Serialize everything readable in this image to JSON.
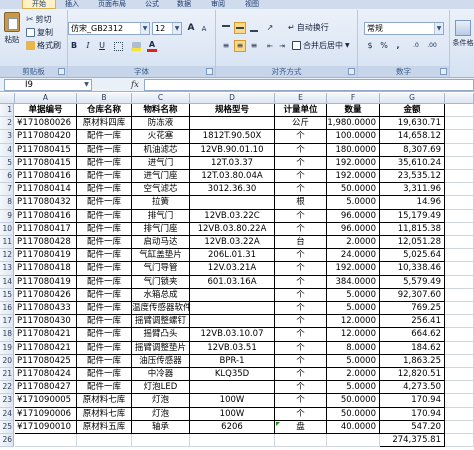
{
  "ribbon": {
    "tabs": [
      "开始",
      "插入",
      "页面布局",
      "公式",
      "数据",
      "审阅",
      "视图"
    ],
    "clipboard": {
      "label": "剪贴板",
      "paste": "粘贴",
      "cut": "剪切",
      "copy": "复制",
      "format_painter": "格式刷"
    },
    "font": {
      "label": "字体",
      "name": "仿宋_GB2312",
      "size": "12",
      "bold": "B",
      "italic": "I",
      "underline": "U",
      "font_color_glyph": "A",
      "grow": "A",
      "shrink": "A"
    },
    "alignment": {
      "label": "对齐方式",
      "wrap": "自动换行",
      "merge": "合并后居中"
    },
    "number": {
      "label": "数字",
      "format": "常规",
      "currency": "$",
      "percent": "%",
      "comma": ",",
      "inc_dec": ".0",
      "dec_dec": ".00"
    },
    "styles": {
      "cond_format": "条件格"
    },
    "colors": {
      "accent": "#fbd98a",
      "font_red": "#e02020",
      "fill_yellow": "#f5e33a",
      "link_blue": "#1e3a6a"
    }
  },
  "formula_bar": {
    "name_box": "I9",
    "fx": "fx",
    "content": ""
  },
  "sheet": {
    "columns": [
      "A",
      "B",
      "C",
      "D",
      "E",
      "F",
      "G"
    ],
    "headers": [
      "单据编号",
      "仓库名称",
      "物料名称",
      "规格型号",
      "计量单位",
      "数量",
      "金额"
    ],
    "row_numbers": [
      "1",
      "2",
      "3",
      "4",
      "5",
      "6",
      "7",
      "8",
      "9",
      "10",
      "11",
      "12",
      "13",
      "14",
      "15",
      "16",
      "17",
      "18",
      "19",
      "20",
      "21",
      "22",
      "23",
      "24",
      "25",
      "26"
    ],
    "rows": [
      [
        "¥171080026",
        "原材料四库",
        "防冻液",
        "",
        "公斤",
        "1,980.0000",
        "19,630.71"
      ],
      [
        "P117080420",
        "配件一库",
        "火花塞",
        "1812T.90.50X",
        "个",
        "100.0000",
        "14,658.12"
      ],
      [
        "P117080415",
        "配件一库",
        "机油滤芯",
        "12VB.90.01.10",
        "个",
        "180.0000",
        "8,307.69"
      ],
      [
        "P117080415",
        "配件一库",
        "进气门",
        "12T.03.37",
        "个",
        "192.0000",
        "35,610.24"
      ],
      [
        "P117080416",
        "配件一库",
        "进气门座",
        "12T.03.80.04A",
        "个",
        "192.0000",
        "23,535.12"
      ],
      [
        "P117080414",
        "配件一库",
        "空气滤芯",
        "3012.36.30",
        "个",
        "50.0000",
        "3,311.96"
      ],
      [
        "P117080432",
        "配件一库",
        "拉簧",
        "",
        "根",
        "5.0000",
        "14.96"
      ],
      [
        "P117080416",
        "配件一库",
        "排气门",
        "12VB.03.22C",
        "个",
        "96.0000",
        "15,179.49"
      ],
      [
        "P117080417",
        "配件一库",
        "排气门座",
        "12VB.03.80.22A",
        "个",
        "96.0000",
        "11,815.38"
      ],
      [
        "P117080428",
        "配件一库",
        "启动马达",
        "12VB.03.22A",
        "台",
        "2.0000",
        "12,051.28"
      ],
      [
        "P117080419",
        "配件一库",
        "气缸盖垫片",
        "206L.01.31",
        "个",
        "24.0000",
        "5,025.64"
      ],
      [
        "P117080418",
        "配件一库",
        "气门导管",
        "12V.03.21A",
        "个",
        "192.0000",
        "10,338.46"
      ],
      [
        "P117080419",
        "配件一库",
        "气门锁夹",
        "601.03.16A",
        "个",
        "384.0000",
        "5,579.49"
      ],
      [
        "P117080426",
        "配件一库",
        "水箱总成",
        "",
        "个",
        "5.0000",
        "92,307.60"
      ],
      [
        "P117080433",
        "配件一库",
        "温度传感器软件",
        "",
        "个",
        "5.0000",
        "769.25"
      ],
      [
        "P117080430",
        "配件一库",
        "摇臂调整螺钉",
        "",
        "个",
        "12.0000",
        "256.41"
      ],
      [
        "P117080421",
        "配件一库",
        "摇臂凸头",
        "12VB.03.10.07",
        "个",
        "12.0000",
        "664.62"
      ],
      [
        "P117080421",
        "配件一库",
        "摇臂调整垫片",
        "12VB.03.51",
        "个",
        "8.0000",
        "184.62"
      ],
      [
        "P117080425",
        "配件一库",
        "油压传感器",
        "BPR-1",
        "个",
        "5.0000",
        "1,863.25"
      ],
      [
        "P117080424",
        "配件一库",
        "中冷器",
        "KLQ35D",
        "个",
        "2.0000",
        "12,820.51"
      ],
      [
        "P117080427",
        "配件一库",
        "灯泡LED",
        "",
        "个",
        "5.0000",
        "4,273.50"
      ],
      [
        "¥171090005",
        "原材料七库",
        "灯泡",
        "100W",
        "个",
        "50.0000",
        "170.94"
      ],
      [
        "¥171090006",
        "原材料七库",
        "灯泡",
        "100W",
        "个",
        "50.0000",
        "170.94"
      ],
      [
        "¥171090010",
        "原材料五库",
        "轴承",
        "6206",
        "盘",
        "40.0000",
        "547.20"
      ],
      [
        "",
        "",
        "",
        "",
        "",
        "",
        "274,375.81"
      ]
    ]
  }
}
